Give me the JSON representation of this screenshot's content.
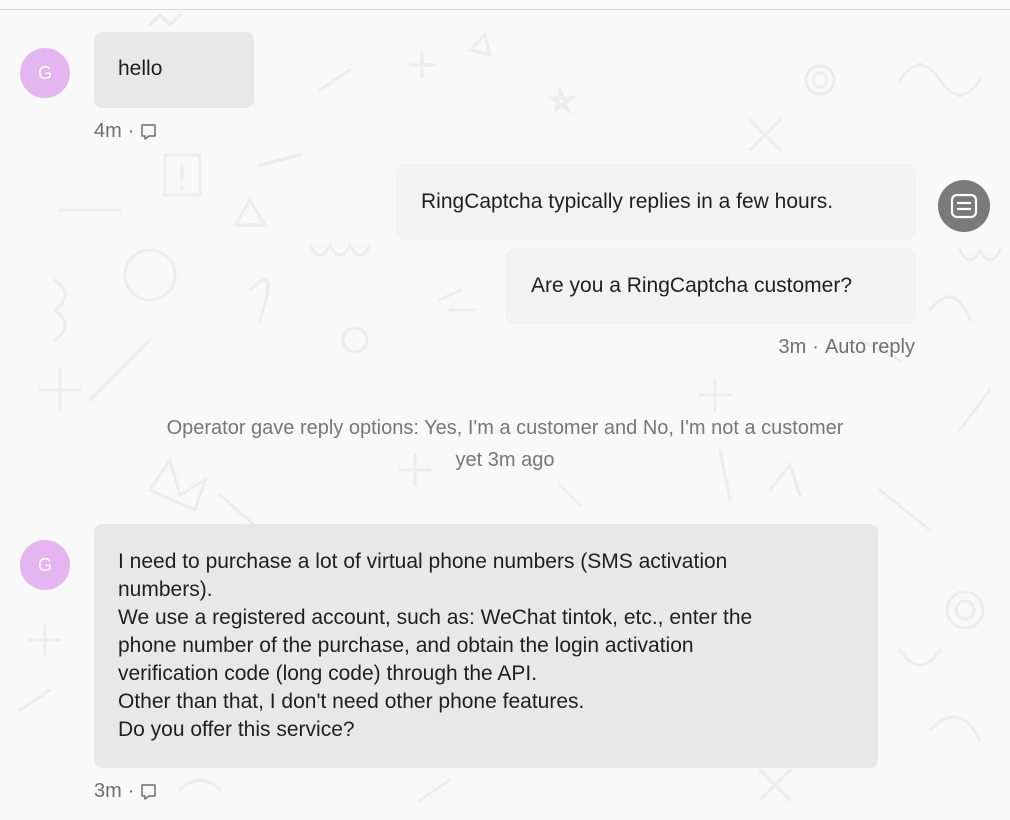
{
  "messages": {
    "first": {
      "avatar_initial": "G",
      "text": "hello",
      "time": "4m",
      "separator": "·"
    },
    "bot_reply_1": {
      "text": "RingCaptcha typically replies in a few hours."
    },
    "bot_reply_2": {
      "text": "Are you a RingCaptcha customer?",
      "time": "3m",
      "separator": "·",
      "status": "Auto reply"
    },
    "system_note": {
      "line1": "Operator gave reply options: Yes, I'm a customer and No, I'm not a customer",
      "line2": "yet 3m ago"
    },
    "second": {
      "avatar_initial": "G",
      "lines": [
        "I need to purchase a lot of virtual phone numbers (SMS activation",
        "numbers).",
        "We use a registered account, such as: WeChat tintok, etc., enter the",
        "phone number of the purchase, and obtain the login activation",
        "verification code (long code) through the API.",
        "Other than that, I don't need other phone features.",
        "Do you offer this service?"
      ],
      "time": "3m",
      "separator": "·"
    }
  },
  "colors": {
    "avatar_bg": "#e5b5f0",
    "bot_avatar_bg": "#7a7a7a",
    "user_bubble": "#e8e8e8",
    "bot_bubble": "#f2f2f2"
  },
  "icons": {
    "seen": "seen-icon",
    "bot": "bot-avatar-icon"
  }
}
